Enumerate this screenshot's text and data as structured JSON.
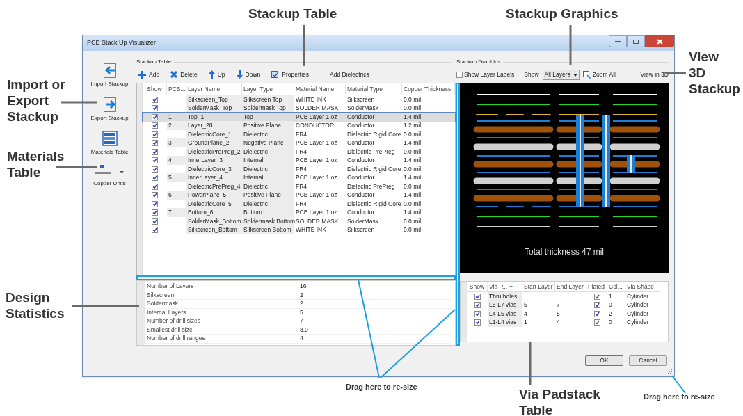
{
  "window": {
    "title": "PCB Stack Up Visualizer"
  },
  "side_toolbar": [
    {
      "kind": "import",
      "label": "Import Stackup"
    },
    {
      "kind": "export",
      "label": "Export Stackup"
    },
    {
      "kind": "materials",
      "label": "Materials Table"
    },
    {
      "kind": "copper",
      "label": "Copper Units"
    }
  ],
  "stackup_table": {
    "group_title": "Stackup Table",
    "toolbar": [
      {
        "kind": "add",
        "label": "Add"
      },
      {
        "kind": "delete",
        "label": "Delete"
      },
      {
        "kind": "up",
        "label": "Up"
      },
      {
        "kind": "down",
        "label": "Down"
      },
      {
        "kind": "properties",
        "label": "Properties"
      },
      {
        "kind": "text",
        "label": "Add Dielectrics"
      }
    ],
    "columns": [
      "Show",
      "PCB...",
      "Layer Name",
      "Layer Type",
      "Material Name",
      "Material Type",
      "Copper Thickness"
    ],
    "rows": [
      {
        "show": true,
        "selected": false,
        "pcb": "",
        "name": "Silkscreen_Top",
        "type": "Silkscreen Top",
        "material": "WHITE INK",
        "material_type": "Silkscreen",
        "thickness": "0.0 mil"
      },
      {
        "show": true,
        "selected": false,
        "pcb": "",
        "name": "SolderMask_Top",
        "type": "Soldermask Top",
        "material": "SOLDER MASK",
        "material_type": "SolderMask",
        "thickness": "0.0 mil"
      },
      {
        "show": true,
        "selected": true,
        "pcb": "1",
        "name": "Top_1",
        "type": "Top",
        "material": "PCB Layer 1 oz",
        "material_type": "Conductor",
        "thickness": "1.4 mil"
      },
      {
        "show": true,
        "selected": false,
        "pcb": "2",
        "name": "Layer_28",
        "type": "Positive Plane",
        "material": "CONDUCTOR",
        "material_type": "Conductor",
        "thickness": "1.2 mil"
      },
      {
        "show": true,
        "selected": false,
        "pcb": "",
        "name": "DielectricCore_1",
        "type": "Dielectric",
        "material": "FR4",
        "material_type": "Dielectric Rigid Core",
        "thickness": "0.0 mil"
      },
      {
        "show": true,
        "selected": false,
        "pcb": "3",
        "name": "GroundPlane_2",
        "type": "Negative Plane",
        "material": "PCB Layer 1 oz",
        "material_type": "Conductor",
        "thickness": "1.4 mil"
      },
      {
        "show": true,
        "selected": false,
        "pcb": "",
        "name": "DielectricPrePreg_2",
        "type": "Dielectric",
        "material": "FR4",
        "material_type": "Dielectric PrePreg",
        "thickness": "0.0 mil"
      },
      {
        "show": true,
        "selected": false,
        "pcb": "4",
        "name": "InnerLayer_3",
        "type": "Internal",
        "material": "PCB Layer 1 oz",
        "material_type": "Conductor",
        "thickness": "1.4 mil"
      },
      {
        "show": true,
        "selected": false,
        "pcb": "",
        "name": "DielectricCore_3",
        "type": "Dielectric",
        "material": "FR4",
        "material_type": "Dielectric Rigid Core",
        "thickness": "0.0 mil"
      },
      {
        "show": true,
        "selected": false,
        "pcb": "5",
        "name": "InnerLayer_4",
        "type": "Internal",
        "material": "PCB Layer 1 oz",
        "material_type": "Conductor",
        "thickness": "1.4 mil"
      },
      {
        "show": true,
        "selected": false,
        "pcb": "",
        "name": "DielectricPrePreg_4",
        "type": "Dielectric",
        "material": "FR4",
        "material_type": "Dielectric PrePreg",
        "thickness": "0.0 mil"
      },
      {
        "show": true,
        "selected": false,
        "pcb": "6",
        "name": "PowerPlane_5",
        "type": "Positive Plane",
        "material": "PCB Layer 1 oz",
        "material_type": "Conductor",
        "thickness": "1.4 mil"
      },
      {
        "show": true,
        "selected": false,
        "pcb": "",
        "name": "DielectricCore_5",
        "type": "Dielectric",
        "material": "FR4",
        "material_type": "Dielectric Rigid Core",
        "thickness": "0.0 mil"
      },
      {
        "show": true,
        "selected": false,
        "pcb": "7",
        "name": "Bottom_6",
        "type": "Bottom",
        "material": "PCB Layer 1 oz",
        "material_type": "Conductor",
        "thickness": "1.4 mil"
      },
      {
        "show": true,
        "selected": false,
        "pcb": "",
        "name": "SolderMask_Bottom",
        "type": "Soldermask Bottom",
        "material": "SOLDER MASK",
        "material_type": "SolderMask",
        "thickness": "0.0 mil"
      },
      {
        "show": true,
        "selected": false,
        "pcb": "",
        "name": "Silkscreen_Bottom",
        "type": "Silkscreen Bottom",
        "material": "WHITE INK",
        "material_type": "Silkscreen",
        "thickness": "0.0 mil"
      }
    ]
  },
  "statistics": [
    {
      "label": "Number of Layers",
      "value": "16"
    },
    {
      "label": "Silkscreen",
      "value": "2"
    },
    {
      "label": "Soldermask",
      "value": "2"
    },
    {
      "label": "Internal Layers",
      "value": "5"
    },
    {
      "label": "Number of drill sizes",
      "value": "7"
    },
    {
      "label": "Smallest drill size",
      "value": "8.0"
    },
    {
      "label": "Number of drill ranges",
      "value": "4"
    }
  ],
  "stackup_graphics": {
    "group_title": "Stackup Graphics",
    "show_layer_labels": {
      "label": "Show Layer Labels",
      "checked": false
    },
    "show_label": "Show",
    "show_value": "All Layers",
    "zoom_all": "Zoom All",
    "view_3d": "View in 3D",
    "total": "Total thickness 47 mil"
  },
  "via_table": {
    "columns": [
      "Show",
      "Via P...",
      "Start Layer",
      "End Layer",
      "Plated",
      "Col...",
      "Via Shape"
    ],
    "rows": [
      {
        "show": true,
        "name": "Thru holes",
        "start": "",
        "end": "",
        "plated": true,
        "col": "1",
        "shape": "Cylinder"
      },
      {
        "show": true,
        "name": "L5-L7 vias",
        "start": "5",
        "end": "7",
        "plated": true,
        "col": "0",
        "shape": "Cylinder"
      },
      {
        "show": true,
        "name": "L4-L5 vias",
        "start": "4",
        "end": "5",
        "plated": true,
        "col": "2",
        "shape": "Cylinder"
      },
      {
        "show": true,
        "name": "L1-L4 vias",
        "start": "1",
        "end": "4",
        "plated": true,
        "col": "0",
        "shape": "Cylinder"
      }
    ]
  },
  "buttons": [
    "OK",
    "Cancel"
  ],
  "callouts": [
    {
      "kind": "large",
      "lines": [
        "Stackup Table"
      ]
    },
    {
      "kind": "large",
      "lines": [
        "Stackup Graphics"
      ]
    },
    {
      "kind": "large",
      "lines": [
        "View",
        "3D",
        "Stackup"
      ]
    },
    {
      "kind": "large",
      "lines": [
        "Import or",
        "Export",
        "Stackup"
      ]
    },
    {
      "kind": "large",
      "lines": [
        "Materials",
        "Table"
      ]
    },
    {
      "kind": "large",
      "lines": [
        "Design",
        "Statistics"
      ]
    },
    {
      "kind": "small",
      "lines": [
        "Drag here to re-size"
      ]
    },
    {
      "kind": "large",
      "lines": [
        "Via Padstack",
        "Table"
      ]
    },
    {
      "kind": "small",
      "lines": [
        "Drag here to re-size"
      ]
    }
  ]
}
